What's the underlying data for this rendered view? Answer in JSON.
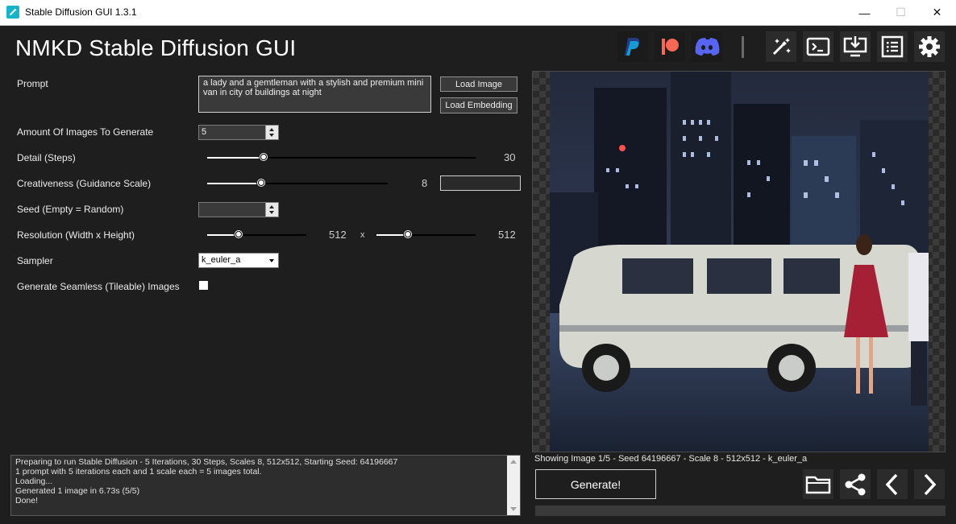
{
  "window": {
    "title": "Stable Diffusion GUI 1.3.1",
    "minimize": "—",
    "maximize": "☐",
    "close": "✕"
  },
  "app": {
    "title": "NMKD Stable Diffusion GUI"
  },
  "header_icons": [
    "paypal-icon",
    "patreon-icon",
    "discord-icon",
    "magic-wand-icon",
    "terminal-icon",
    "install-icon",
    "list-icon",
    "gear-icon"
  ],
  "form": {
    "prompt_label": "Prompt",
    "prompt_value": "a lady and a gemtleman with a stylish and premium mini van in city of buildings at night",
    "load_image": "Load Image",
    "load_embedding": "Load Embedding",
    "amount_label": "Amount Of Images To Generate",
    "amount_value": "5",
    "steps_label": "Detail (Steps)",
    "steps_value": "30",
    "steps_fraction": 0.21,
    "scale_label": "Creativeness (Guidance Scale)",
    "scale_value": "8",
    "scale_fraction": 0.3,
    "seed_label": "Seed (Empty = Random)",
    "seed_value": "",
    "resolution_label": "Resolution (Width x Height)",
    "width_value": "512",
    "height_value": "512",
    "res_x": "x",
    "width_fraction": 0.32,
    "height_fraction": 0.32,
    "sampler_label": "Sampler",
    "sampler_value": "k_euler_a",
    "seamless_label": "Generate Seamless (Tileable) Images",
    "seamless_checked": false
  },
  "log": {
    "lines": [
      "Preparing to run Stable Diffusion - 5 Iterations, 30 Steps, Scales 8, 512x512, Starting Seed: 64196667",
      "1 prompt with 5 iterations each and 1 scale each = 5 images total.",
      "Loading...",
      "Generated 1 image in 6.73s (5/5)",
      "Done!"
    ]
  },
  "preview": {
    "status": "Showing Image 1/5  - Seed 64196667 - Scale 8 - 512x512 - k_euler_a"
  },
  "actions": {
    "generate": "Generate!",
    "buttons": [
      "folder-icon",
      "share-icon",
      "chevron-left-icon",
      "chevron-right-icon"
    ]
  },
  "progress": {
    "fraction": 0.0
  },
  "colors": {
    "background": "#1e1e1e",
    "panel": "#2b2b2b",
    "paypal": "#1f6fd0",
    "patreon": "#f96854",
    "discord": "#5865f2"
  }
}
